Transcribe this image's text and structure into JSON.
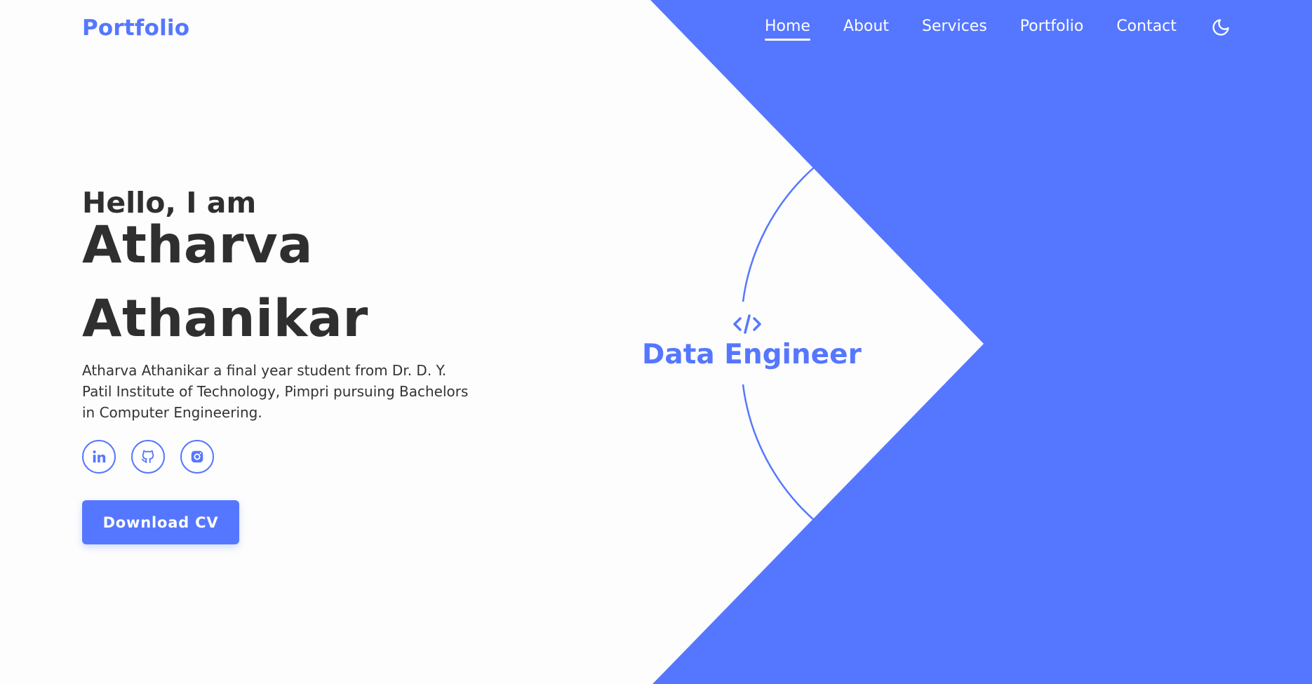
{
  "colors": {
    "accent": "#5577ff",
    "text_dark": "#2f2f2f",
    "background": "#fdfdfd",
    "nav_text": "#ffffff"
  },
  "header": {
    "logo": "Portfolio",
    "nav": [
      {
        "label": "Home",
        "active": true
      },
      {
        "label": "About",
        "active": false
      },
      {
        "label": "Services",
        "active": false
      },
      {
        "label": "Portfolio",
        "active": false
      },
      {
        "label": "Contact",
        "active": false
      }
    ],
    "theme_toggle_icon": "moon-icon"
  },
  "hero": {
    "greeting": "Hello, I am",
    "name_first": "Atharva",
    "name_last": "Athanikar",
    "description": "Atharva Athanikar a final year student from Dr. D. Y. Patil Institute of Technology, Pimpri pursuing Bachelors in Computer Engineering.",
    "socials": [
      {
        "icon": "linkedin-icon"
      },
      {
        "icon": "github-icon"
      },
      {
        "icon": "instagram-icon"
      }
    ],
    "cv_button": "Download CV"
  },
  "role": {
    "icon": "code-icon",
    "title": "Data Engineer"
  }
}
